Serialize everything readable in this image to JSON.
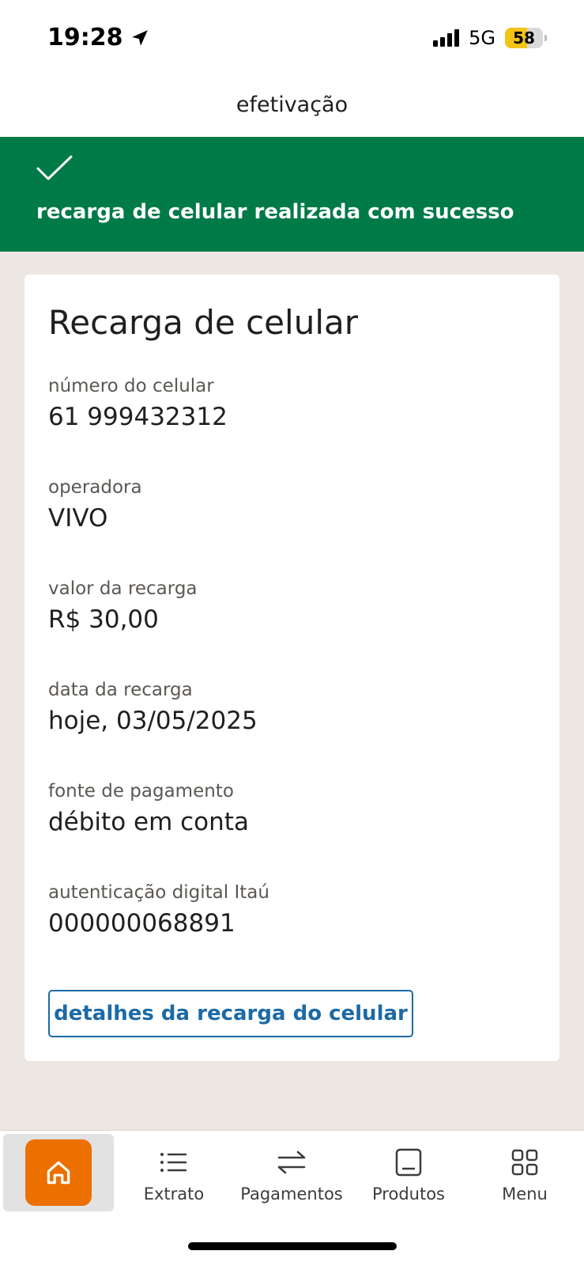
{
  "status_bar": {
    "time": "19:28",
    "network": "5G",
    "battery": "58",
    "icons": [
      "location-arrow-icon",
      "signal-icon",
      "battery-icon"
    ]
  },
  "header": {
    "title": "efetivação"
  },
  "banner": {
    "icon": "check-icon",
    "message": "recarga de celular realizada com sucesso",
    "color": "#007a47"
  },
  "receipt": {
    "title": "Recarga de celular",
    "fields": [
      {
        "label": "número do celular",
        "value": "61 999432312"
      },
      {
        "label": "operadora",
        "value": "VIVO"
      },
      {
        "label": "valor da recarga",
        "value": "R$ 30,00"
      },
      {
        "label": "data da recarga",
        "value": "hoje, 03/05/2025"
      },
      {
        "label": "fonte de pagamento",
        "value": "débito em conta"
      },
      {
        "label": "autenticação digital Itaú",
        "value": "000000068891"
      }
    ],
    "details_button": "detalhes da recarga do celular",
    "button_color": "#1c6aa6"
  },
  "bottom_nav": {
    "accent": "#ec7000",
    "items": [
      {
        "label": "",
        "icon": "home-icon",
        "active": true
      },
      {
        "label": "Extrato",
        "icon": "list-icon"
      },
      {
        "label": "Pagamentos",
        "icon": "transfer-arrows-icon"
      },
      {
        "label": "Produtos",
        "icon": "card-icon"
      },
      {
        "label": "Menu",
        "icon": "grid-icon"
      }
    ]
  }
}
